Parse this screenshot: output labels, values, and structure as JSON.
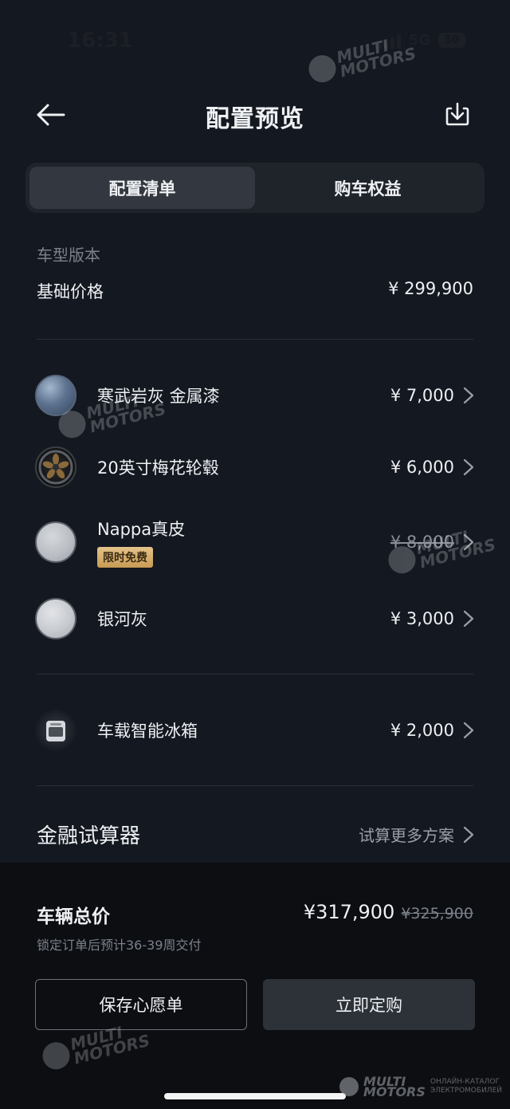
{
  "status_bar": {
    "time": "16:31",
    "network": "5G",
    "battery": "50"
  },
  "header": {
    "title": "配置预览",
    "back_icon": "arrow-left-icon",
    "download_icon": "download-icon"
  },
  "tabs": [
    {
      "label": "配置清单",
      "active": true
    },
    {
      "label": "购车权益",
      "active": false
    }
  ],
  "base": {
    "section_label": "车型版本",
    "label": "基础价格",
    "price": "¥ 299,900"
  },
  "options": [
    {
      "name": "寒武岩灰 金属漆",
      "price": "¥ 7,000",
      "thumb": "paint-swatch"
    },
    {
      "name": "20英寸梅花轮毂",
      "price": "¥ 6,000",
      "thumb": "wheel"
    },
    {
      "name": "Nappa真皮",
      "price": "¥ 8,000",
      "badge": "限时免费",
      "strikethrough": true,
      "thumb": "leather-swatch"
    },
    {
      "name": "银河灰",
      "price": "¥ 3,000",
      "thumb": "interior-swatch"
    },
    {
      "name": "车载智能冰箱",
      "price": "¥ 2,000",
      "thumb": "fridge"
    }
  ],
  "finance": {
    "title": "金融试算器",
    "link": "试算更多方案"
  },
  "summary": {
    "label": "车辆总价",
    "price": "¥317,900",
    "original_price": "¥325,900",
    "delivery_note": "锁定订单后预计36-39周交付"
  },
  "actions": {
    "wishlist": "保存心愿单",
    "order": "立即定购"
  },
  "watermark": {
    "brand_line1": "MULTI",
    "brand_line2": "MOTORS",
    "caption_line1": "ОНЛАЙН-КАТАЛОГ",
    "caption_line2": "ЭЛЕКТРОМОБИЛЕЙ"
  },
  "colors": {
    "background": "#141820",
    "panel": "#0c0e12",
    "badge": "#d8b373"
  }
}
